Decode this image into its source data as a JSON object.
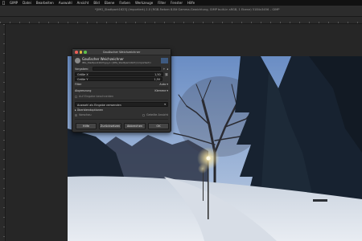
{
  "menubar": {
    "apple_icon": "apple-icon",
    "items": [
      "GIMP",
      "Datei",
      "Bearbeiten",
      "Auswahl",
      "Ansicht",
      "Bild",
      "Ebene",
      "Farben",
      "Werkzeuge",
      "Filter",
      "Fenster",
      "Hilfe"
    ]
  },
  "window": {
    "title": "*[IMG_Stadtpark1623] (importiert)-1.0 (RGB-Farben 8-Bit Gamma-Gewichtung, GIMP built-in sRGB, 1 Ebene) 5184x3456 – GIMP"
  },
  "dialog": {
    "title": "Gaußscher Weichzeichner",
    "header_main": "Gaußscher Weichzeichner",
    "header_sub": "IMG_Stadtpark1623.jpg-1 ([IMG_Stadtpark1623] (importiert))",
    "presets_label": "Vorgaben:",
    "presets_value": "",
    "size_x_label": "Größe X",
    "size_x_value": "1,50",
    "size_y_label": "Größe Y",
    "size_y_value": "1,50",
    "filter_label": "Filter",
    "filter_value": "Auto",
    "abyss_label": "Abgrenzung",
    "abyss_value": "Klemme",
    "clip_label": "Auf Eingabe beschneiden",
    "blend_label": "Überblendoptionen",
    "crop_label": "Auswahl als Eingabe verwenden",
    "preview_label": "Vorschau",
    "split_label": "Geteilte Ansicht",
    "btn_help": "Hilfe",
    "btn_reset": "Zurücksetzen",
    "btn_cancel": "Abbrechen",
    "btn_ok": "OK"
  },
  "colors": {
    "menubar_bg": "#111111",
    "dialog_bg": "#303030",
    "sky_top": "#6c8fc4",
    "snow": "#dfe4ec"
  }
}
